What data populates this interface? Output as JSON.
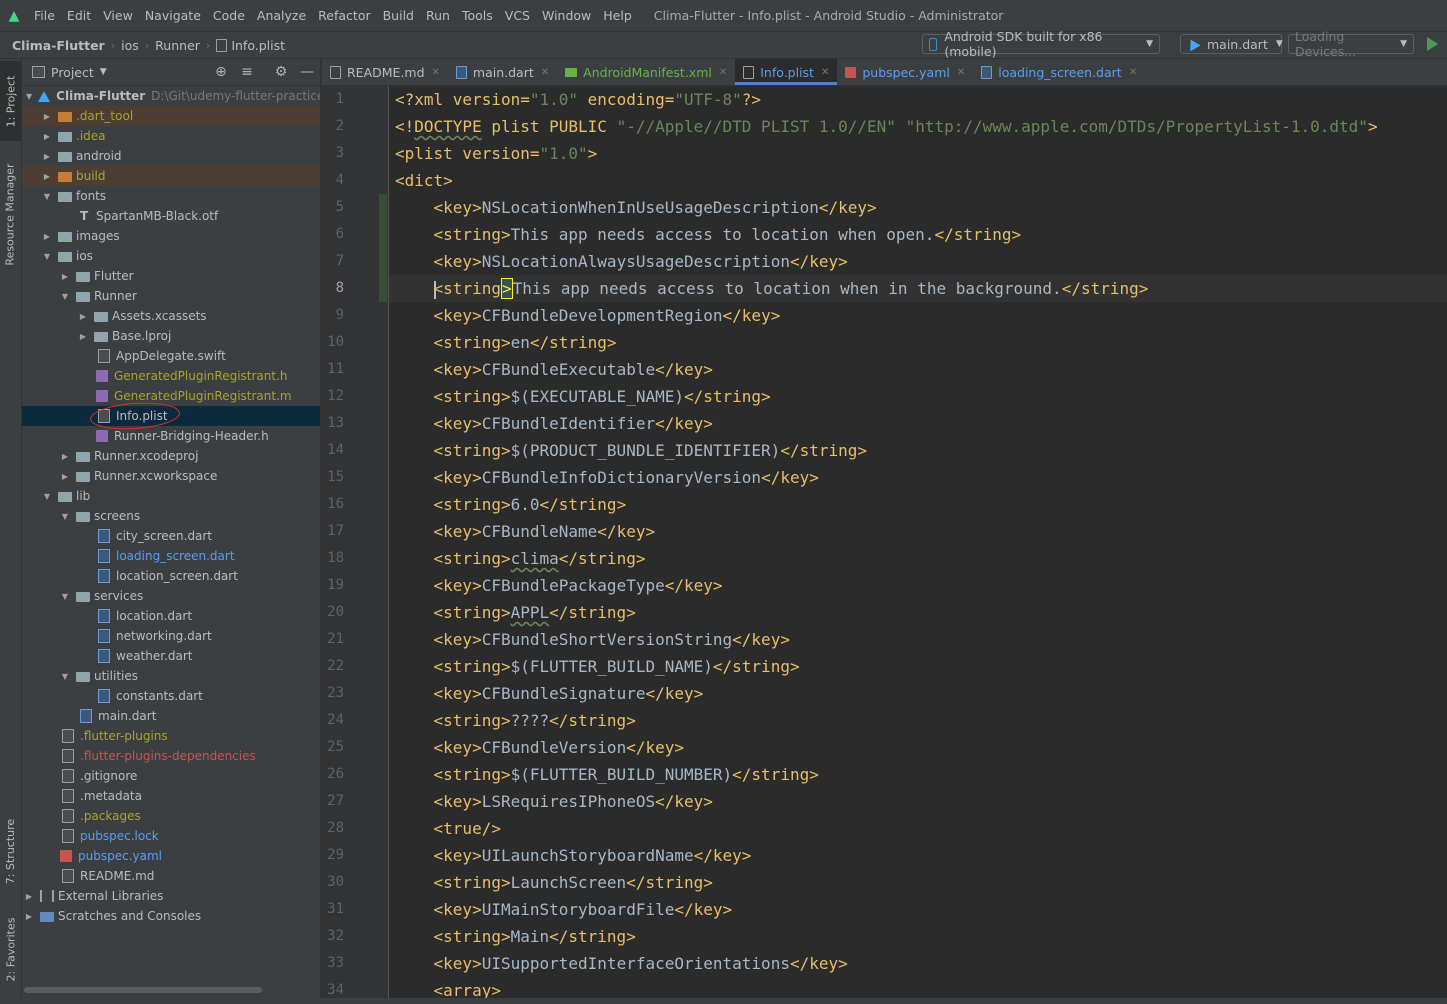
{
  "menubar": {
    "items": [
      "File",
      "Edit",
      "View",
      "Navigate",
      "Code",
      "Analyze",
      "Refactor",
      "Build",
      "Run",
      "Tools",
      "VCS",
      "Window",
      "Help"
    ],
    "window_title": "Clima-Flutter - Info.plist - Android Studio - Administrator"
  },
  "navbar": {
    "breadcrumbs": [
      "Clima-Flutter",
      "ios",
      "Runner",
      "Info.plist"
    ],
    "device_selector": "Android SDK built for x86 (mobile)",
    "run_config": "main.dart",
    "devices_loading": "Loading Devices..."
  },
  "left_strip": {
    "project_tab": "1: Project",
    "resource_manager_tab": "Resource Manager",
    "structure_tab": "7: Structure",
    "favorites_tab": "2: Favorites"
  },
  "project_pane": {
    "view_mode": "Project",
    "tree": [
      {
        "label": "Clima-Flutter",
        "path": "D:\\Git\\udemy-flutter-practice\\C",
        "expanded": true
      },
      {
        "label": ".dart_tool",
        "expanded": false
      },
      {
        "label": ".idea",
        "expanded": false
      },
      {
        "label": "android",
        "expanded": false
      },
      {
        "label": "build",
        "expanded": false
      },
      {
        "label": "fonts",
        "expanded": true
      },
      {
        "label": "SpartanMB-Black.otf"
      },
      {
        "label": "images",
        "expanded": false
      },
      {
        "label": "ios",
        "expanded": true
      },
      {
        "label": "Flutter",
        "expanded": false
      },
      {
        "label": "Runner",
        "expanded": true
      },
      {
        "label": "Assets.xcassets",
        "expanded": false
      },
      {
        "label": "Base.lproj",
        "expanded": false
      },
      {
        "label": "AppDelegate.swift"
      },
      {
        "label": "GeneratedPluginRegistrant.h"
      },
      {
        "label": "GeneratedPluginRegistrant.m"
      },
      {
        "label": "Info.plist",
        "selected": true
      },
      {
        "label": "Runner-Bridging-Header.h"
      },
      {
        "label": "Runner.xcodeproj",
        "expanded": false
      },
      {
        "label": "Runner.xcworkspace",
        "expanded": false
      },
      {
        "label": "lib",
        "expanded": true
      },
      {
        "label": "screens",
        "expanded": true
      },
      {
        "label": "city_screen.dart"
      },
      {
        "label": "loading_screen.dart"
      },
      {
        "label": "location_screen.dart"
      },
      {
        "label": "services",
        "expanded": true
      },
      {
        "label": "location.dart"
      },
      {
        "label": "networking.dart"
      },
      {
        "label": "weather.dart"
      },
      {
        "label": "utilities",
        "expanded": true
      },
      {
        "label": "constants.dart"
      },
      {
        "label": "main.dart"
      },
      {
        "label": ".flutter-plugins"
      },
      {
        "label": ".flutter-plugins-dependencies"
      },
      {
        "label": ".gitignore"
      },
      {
        "label": ".metadata"
      },
      {
        "label": ".packages"
      },
      {
        "label": "pubspec.lock"
      },
      {
        "label": "pubspec.yaml"
      },
      {
        "label": "README.md"
      },
      {
        "label": "External Libraries",
        "expanded": false
      },
      {
        "label": "Scratches and Consoles",
        "expanded": false
      }
    ]
  },
  "editor": {
    "tabs": [
      {
        "label": "README.md"
      },
      {
        "label": "main.dart"
      },
      {
        "label": "AndroidManifest.xml"
      },
      {
        "label": "Info.plist",
        "active": true
      },
      {
        "label": "pubspec.yaml"
      },
      {
        "label": "loading_screen.dart"
      }
    ],
    "current_line": 8,
    "lines": [
      {
        "n": "1",
        "text": "<?xml version=\"1.0\" encoding=\"UTF-8\"?>"
      },
      {
        "n": "2",
        "text": "<!DOCTYPE plist PUBLIC \"-//Apple//DTD PLIST 1.0//EN\" \"http://www.apple.com/DTDs/PropertyList-1.0.dtd\">"
      },
      {
        "n": "3",
        "text": "<plist version=\"1.0\">"
      },
      {
        "n": "4",
        "text": "<dict>"
      },
      {
        "n": "5",
        "text": "    <key>NSLocationWhenInUseUsageDescription</key>"
      },
      {
        "n": "6",
        "text": "    <string>This app needs access to location when open.</string>"
      },
      {
        "n": "7",
        "text": "    <key>NSLocationAlwaysUsageDescription</key>"
      },
      {
        "n": "8",
        "text": "    <string>This app needs access to location when in the background.</string>"
      },
      {
        "n": "9",
        "text": "    <key>CFBundleDevelopmentRegion</key>"
      },
      {
        "n": "10",
        "text": "    <string>en</string>"
      },
      {
        "n": "11",
        "text": "    <key>CFBundleExecutable</key>"
      },
      {
        "n": "12",
        "text": "    <string>$(EXECUTABLE_NAME)</string>"
      },
      {
        "n": "13",
        "text": "    <key>CFBundleIdentifier</key>"
      },
      {
        "n": "14",
        "text": "    <string>$(PRODUCT_BUNDLE_IDENTIFIER)</string>"
      },
      {
        "n": "15",
        "text": "    <key>CFBundleInfoDictionaryVersion</key>"
      },
      {
        "n": "16",
        "text": "    <string>6.0</string>"
      },
      {
        "n": "17",
        "text": "    <key>CFBundleName</key>"
      },
      {
        "n": "18",
        "text": "    <string>clima</string>"
      },
      {
        "n": "19",
        "text": "    <key>CFBundlePackageType</key>"
      },
      {
        "n": "20",
        "text": "    <string>APPL</string>"
      },
      {
        "n": "21",
        "text": "    <key>CFBundleShortVersionString</key>"
      },
      {
        "n": "22",
        "text": "    <string>$(FLUTTER_BUILD_NAME)</string>"
      },
      {
        "n": "23",
        "text": "    <key>CFBundleSignature</key>"
      },
      {
        "n": "24",
        "text": "    <string>????</string>"
      },
      {
        "n": "25",
        "text": "    <key>CFBundleVersion</key>"
      },
      {
        "n": "26",
        "text": "    <string>$(FLUTTER_BUILD_NUMBER)</string>"
      },
      {
        "n": "27",
        "text": "    <key>LSRequiresIPhoneOS</key>"
      },
      {
        "n": "28",
        "text": "    <true/>"
      },
      {
        "n": "29",
        "text": "    <key>UILaunchStoryboardName</key>"
      },
      {
        "n": "30",
        "text": "    <string>LaunchScreen</string>"
      },
      {
        "n": "31",
        "text": "    <key>UIMainStoryboardFile</key>"
      },
      {
        "n": "32",
        "text": "    <string>Main</string>"
      },
      {
        "n": "33",
        "text": "    <key>UISupportedInterfaceOrientations</key>"
      },
      {
        "n": "34",
        "text": "    <array>"
      }
    ]
  },
  "colors": {
    "background": "#2b2b2b",
    "panel": "#3c3f41",
    "tag": "#e8bf6a",
    "text": "#a9b7c6",
    "string_value": "#6a8759",
    "selection": "#0d293e",
    "annotation_circle": "#e0302b",
    "tab_underline": "#4a88c7"
  }
}
